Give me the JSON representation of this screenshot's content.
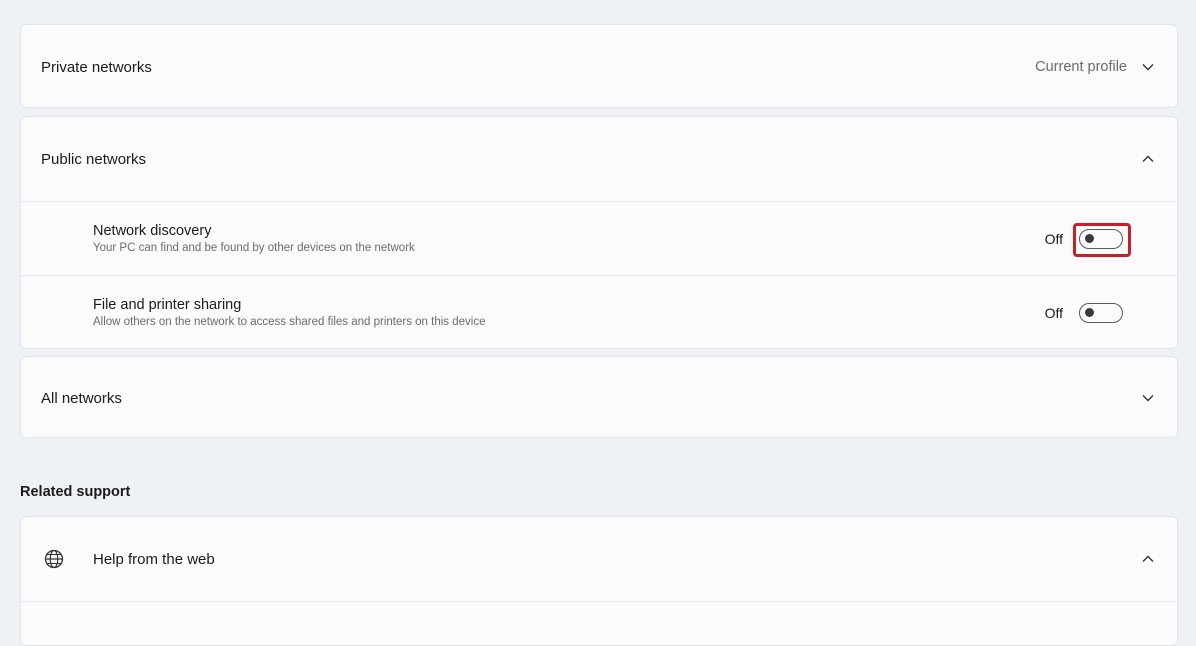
{
  "profiles": {
    "private": {
      "label": "Private networks",
      "status": "Current profile",
      "expanded": false
    },
    "public": {
      "label": "Public networks",
      "expanded": true,
      "settings": [
        {
          "title": "Network discovery",
          "description": "Your PC can find and be found by other devices on the network",
          "state": "Off",
          "highlighted": true,
          "highlight_color": "#c8202a"
        },
        {
          "title": "File and printer sharing",
          "description": "Allow others on the network to access shared files and printers on this device",
          "state": "Off",
          "highlighted": false
        }
      ]
    },
    "all": {
      "label": "All networks",
      "expanded": false
    }
  },
  "related_support": {
    "heading": "Related support",
    "items": [
      {
        "label": "Help from the web",
        "icon": "globe-icon",
        "expanded": true
      }
    ]
  }
}
